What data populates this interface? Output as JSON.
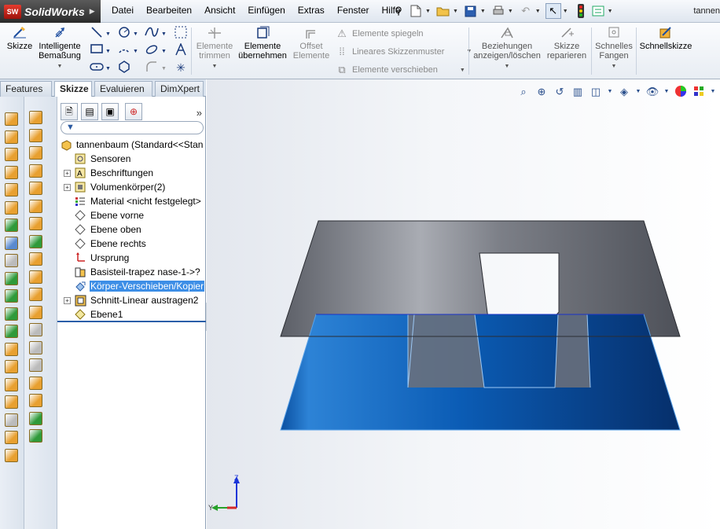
{
  "app": {
    "logo_text": "SolidWorks",
    "logo_badge": "SW",
    "document_title": "tannen"
  },
  "menu": [
    "Datei",
    "Bearbeiten",
    "Ansicht",
    "Einfügen",
    "Extras",
    "Fenster",
    "Hilfe"
  ],
  "command_manager": {
    "skizze": "Skizze",
    "bemassung_1": "Intelligente",
    "bemassung_2": "Bemaßung",
    "trimmen_1": "Elemente",
    "trimmen_2": "trimmen",
    "uebernehmen_1": "Elemente",
    "uebernehmen_2": "übernehmen",
    "offset_1": "Offset",
    "offset_2": "Elemente",
    "spiegeln": "Elemente spiegeln",
    "muster": "Lineares Skizzenmuster",
    "verschieben": "Elemente verschieben",
    "beziehungen_1": "Beziehungen",
    "beziehungen_2": "anzeigen/löschen",
    "reparieren_1": "Skizze",
    "reparieren_2": "reparieren",
    "fangen_1": "Schnelles",
    "fangen_2": "Fangen",
    "schnellskizze": "Schnellskizze"
  },
  "tabs": [
    "Features",
    "Skizze",
    "Evaluieren",
    "DimXpert"
  ],
  "active_tab": "Skizze",
  "feature_tree": {
    "root": "tannenbaum  (Standard<<Stan",
    "items": [
      "Sensoren",
      "Beschriftungen",
      "Volumenkörper(2)",
      "Material <nicht festgelegt>",
      "Ebene vorne",
      "Ebene oben",
      "Ebene rechts",
      "Ursprung",
      "Basisteil-trapez nase-1->?",
      "Körper-Verschieben/Kopier",
      "Schnitt-Linear austragen2",
      "Ebene1"
    ],
    "selected": "Körper-Verschieben/Kopier"
  },
  "triad": {
    "z": "Z",
    "y": "Y"
  },
  "colors": {
    "accent": "#3d8ee6",
    "body_blue": "#0a5fb8",
    "body_gray": "#6d7078"
  }
}
